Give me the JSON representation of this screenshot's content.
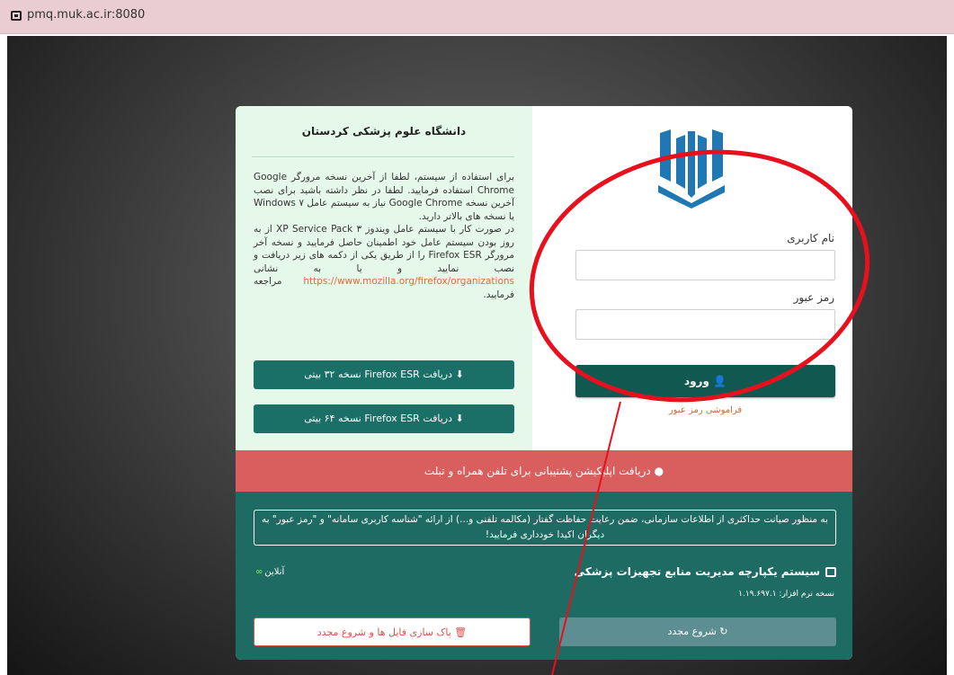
{
  "browser": {
    "url": "pmq.muk.ac.ir:8080"
  },
  "info_panel": {
    "title": "دانشگاه علوم پزشکی کردستان",
    "notice_p1": "برای استفاده از سیستم، لطفا از آخرین نسخه مرورگر Google Chrome استفاده فرمایید. لطفا در نظر داشته باشید برای نصب آخرین نسخه Google Chrome نیاز به سیستم عامل Windows ۷ یا نسخه های بالاتر دارید.",
    "notice_p2": "در صورت کار با سیستم عامل ویندوز XP Service Pack ۳ از به روز بودن سیستم عامل خود اطمینان حاصل فرمایید و نسخه آخر مرورگر Firefox ESR را از طریق یکی از دکمه های زیر دریافت و نصب نمایید و یا به نشانی",
    "notice_link": "https://www.mozilla.org/firefox/organizations",
    "notice_p3": "مراجعه فرمایید.",
    "download_32": "دریافت Firefox ESR نسخه ۳۲ بیتی",
    "download_64": "دریافت Firefox ESR نسخه ۶۴ بیتی"
  },
  "login": {
    "username_label": "نام کاربری",
    "username_value": "",
    "password_label": "رمز عبور",
    "password_value": "",
    "submit": "ورود",
    "forgot": "فراموشی رمز عبور"
  },
  "app_banner": "دریافت اپلیکیشن پشتیبانی برای تلفن همراه و تبلت",
  "footer": {
    "security_notice": "به منظور صیانت حداکثری از اطلاعات سازمانی، ضمن رعایت حفاظت گفتار (مکالمه تلفنی و...) از ارائه \"شناسه کاربری سامانه\" و \"رمز عبور\" به دیگران اکیدا خودداری فرمایید!",
    "system_title": "سیستم یکپارچه مدیریت منابع تجهیزات پزشکی",
    "version": "نسخه نرم افزار: ۱.۱۹.۶۹۷.۱",
    "online": "آنلاین",
    "restart": "شروع مجدد",
    "clear": "پاک سازی فایل ها و شروع مجدد"
  },
  "colors": {
    "teal_dark": "#115950",
    "teal": "#1a6f67",
    "footer_teal": "#1e6b63",
    "banner_red": "#d95f5f",
    "annotation_red": "#e8101c"
  },
  "icons": [
    "browser-site-icon",
    "download-icon",
    "user-icon",
    "android-icon",
    "medical-kit-icon",
    "link-chain-icon",
    "refresh-icon",
    "trash-icon"
  ]
}
